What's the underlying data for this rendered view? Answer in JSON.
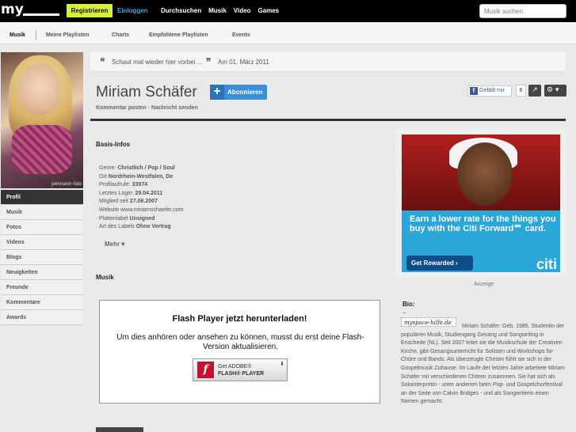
{
  "topbar": {
    "logo": "my",
    "register_label": "Registrieren",
    "login_label": "Einloggen",
    "nav": [
      "Durchsuchen",
      "Musik",
      "Video",
      "Games"
    ],
    "search_placeholder": "Musik suchen"
  },
  "subnav": {
    "items": [
      "Musik",
      "Meine Playlisten",
      "Charts",
      "Empfohlene Playlisten",
      "Events"
    ],
    "active": "Musik"
  },
  "profile": {
    "photo_watermark": "jeimoand~fate",
    "name": "Miriam Schäfer",
    "subscribe_label": "Abonnieren",
    "status_text": "Schaut mal wieder hier vorbei ...",
    "status_date": "Am 01. März 2011",
    "links": [
      "Kommentar posten",
      "Nachricht senden"
    ],
    "facebook_like": "Gefällt mir",
    "like_count": "6"
  },
  "sidemenu": {
    "items": [
      "Profil",
      "Musik",
      "Fotos",
      "Videos",
      "Blogs",
      "Neuigkeiten",
      "Freunde",
      "Kommentare",
      "Awards"
    ],
    "active": "Profil"
  },
  "basis": {
    "heading": "Basis-Infos",
    "rows": [
      {
        "label": "Genre:",
        "value": "Christlich / Pop / Soul"
      },
      {
        "label": "Ort",
        "value": "Nordrhein-Westfalen, De"
      },
      {
        "label": "Profilaufrufe:",
        "value": "33974"
      },
      {
        "label": "Letztes Login:",
        "value": "29.04.2011"
      },
      {
        "label": "Mitglied seit",
        "value": "27.06.2007"
      },
      {
        "label": "Website",
        "value": "www.miriamschaefer.com"
      },
      {
        "label": "Plattenlabel",
        "value": "Unsigned"
      },
      {
        "label": "Art des Labels",
        "value": "Ohne Vertrag"
      }
    ],
    "more_label": "Mehr ▾"
  },
  "musik": {
    "heading": "Musik",
    "flash_title": "Flash Player jetzt herunterladen!",
    "flash_text": "Um dies anhören oder ansehen zu können, musst du erst deine Flash-Version aktualisieren.",
    "get_line1": "Get ADOBE®",
    "get_line2": "FLASH® PLAYER"
  },
  "ad": {
    "copy": "Earn a lower rate for the things you buy with the Citi Forward℠ card.",
    "button": "Get Rewarded ›",
    "brand": "citi",
    "caption": "Anzeige"
  },
  "bio": {
    "heading": "Bio:",
    "dash": "–",
    "signature": "myspace-hilfe.de",
    "text": "Miriam Schäfer: Geb. 1985. Studentin der populären Musik, Studiengang Gesang und Songwriting in Enschede (NL). Seit 2007 leitet sie die Musikschule der Creativen Kirche, gibt Gesangsunterricht für Solisten und Workshops für Chöre und Bands. Als überzeugte Christin fühlt sie sich in der Gospelmusik Zuhause. Im Laufe der letzten Jahre arbeitete Miriam Schäfer mit verschiedenen Chören zusammen. Sie hat sich als Solointerpretin - unter anderem beim Pop- und Gospelchorfestival an der Seite von Calvin Bridges - und als Songwriterin einen Namen gemacht."
  }
}
